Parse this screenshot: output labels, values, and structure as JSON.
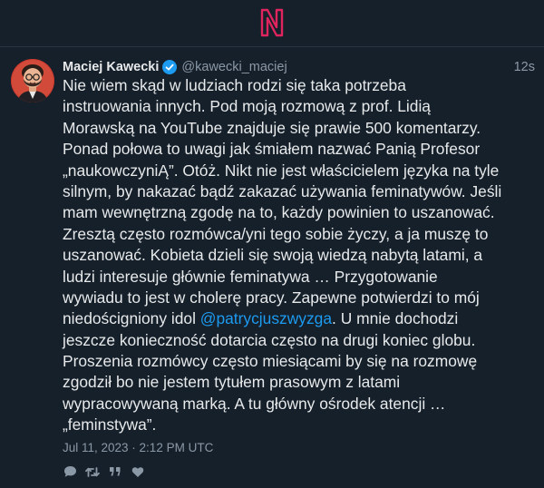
{
  "app": {
    "logo_letter": "N"
  },
  "tweet": {
    "author": {
      "name": "Maciej Kawecki",
      "handle": "@kawecki_maciej",
      "verified": true
    },
    "time_ago": "12s",
    "body": {
      "line1": "Nie wiem skąd w ludziach rodzi się taka potrzeba",
      "line2": "instruowania innych. Pod moją rozmową z prof. Lidią",
      "line3": "Morawską na YouTube znajduje się prawie 500 komentarzy.",
      "line4": "Ponad połowa to uwagi jak śmiałem nazwać Panią Profesor",
      "line5": "„naukowczyniĄ”. Otóż. Nikt nie jest właścicielem języka na tyle",
      "line6": "silnym, by nakazać bądź zakazać używania feminatywów. Jeśli",
      "line7": "mam wewnętrzną zgodę na to, każdy powinien to uszanować.",
      "line8": "Zresztą często rozmówca/yni tego sobie życzy, a ja muszę to",
      "line9": "uszanować. Kobieta dzieli się swoją wiedzą nabytą latami, a",
      "line10": "ludzi interesuje głównie feminatywa … Przygotowanie",
      "line11": "wywiadu to jest w cholerę pracy. Zapewne potwierdzi to mój",
      "line12_before": "niedościgniony idol ",
      "line12_mention": "@patrycjuszwyzga",
      "line12_after": ". U mnie dochodzi",
      "line13": "jeszcze konieczność dotarcia często na drugi koniec globu.",
      "line14": "Proszenia rozmówcy często miesiącami by się na rozmowę",
      "line15": "zgodził bo nie jestem tytułem prasowym z latami",
      "line16": "wypracowywaną marką. A tu główny ośrodek atencji …",
      "line17": "„feminstywa”."
    },
    "timestamp": "Jul 11, 2023 · 2:12 PM UTC"
  },
  "actions": {
    "icons": [
      "comment-icon",
      "retweet-icon",
      "quote-icon",
      "like-icon"
    ]
  },
  "colors": {
    "background": "#15202b",
    "text": "#e7e9ea",
    "muted": "#8b98a5",
    "accent": "#1d9bf0",
    "logo": "#e0245e"
  }
}
